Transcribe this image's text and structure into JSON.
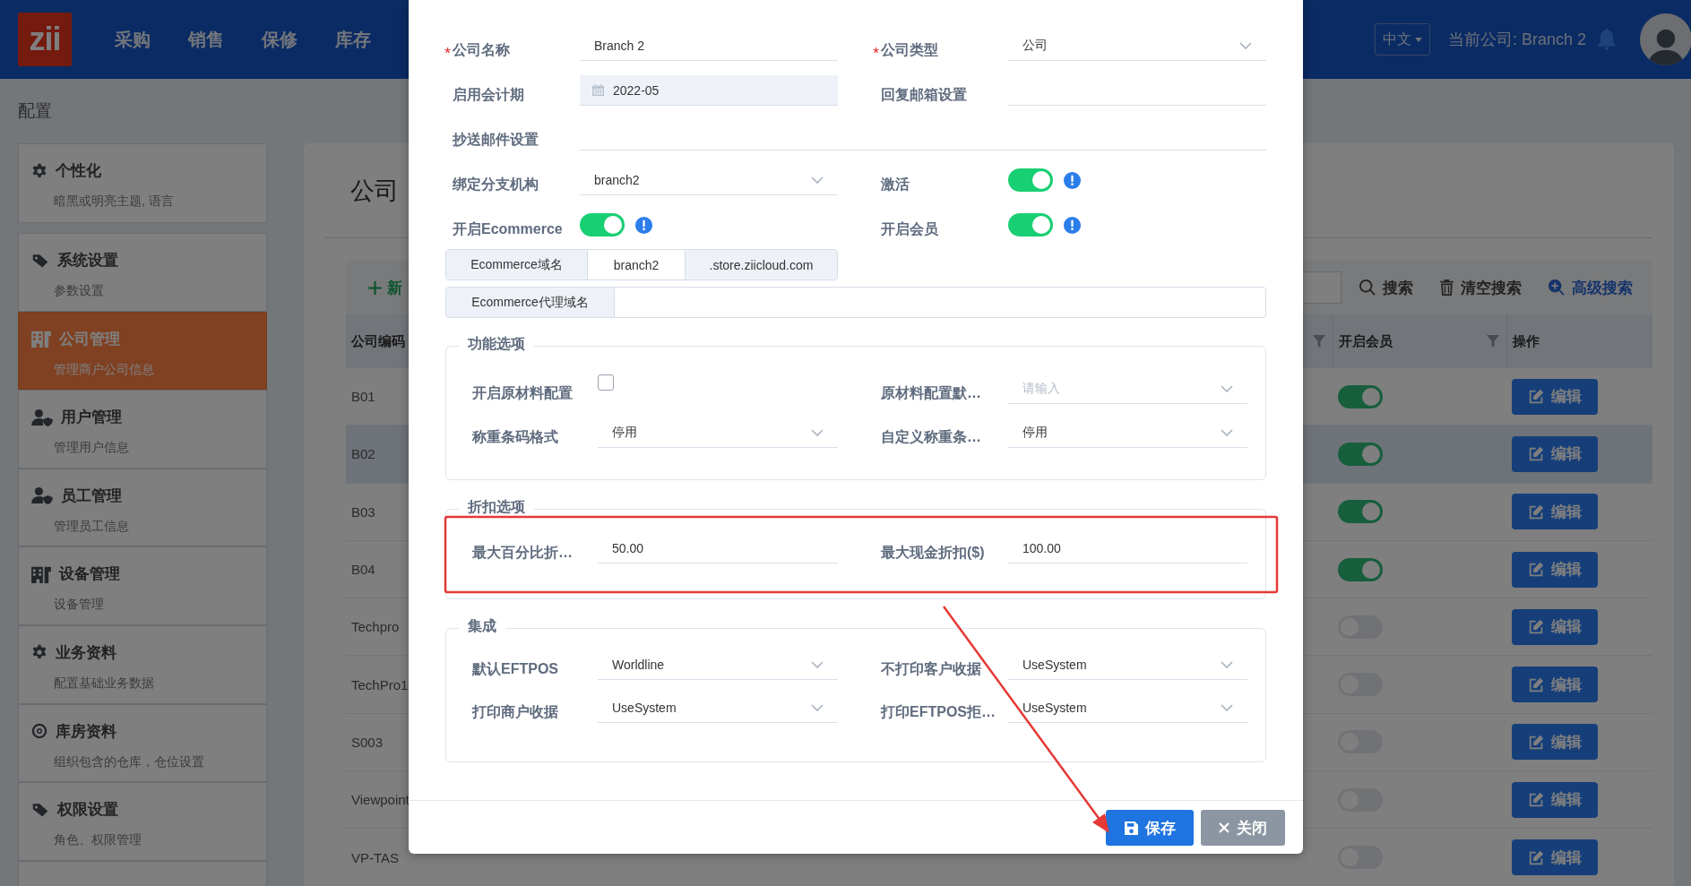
{
  "header": {
    "logo": "zii",
    "menu": [
      {
        "label": "采购"
      },
      {
        "label": "销售"
      },
      {
        "label": "保修"
      },
      {
        "label": "库存"
      }
    ],
    "language": "中文",
    "current_company": "当前公司: Branch 2"
  },
  "page_title": "配置",
  "sidebar": {
    "items": [
      {
        "title": "个性化",
        "subtitle": "暗黑或明亮主题, 语言",
        "selected": false
      },
      {
        "title": "系统设置",
        "subtitle": "参数设置",
        "selected": false
      },
      {
        "title": "公司管理",
        "subtitle": "管理商户公司信息",
        "selected": true
      },
      {
        "title": "用户管理",
        "subtitle": "管理用户信息",
        "selected": false
      },
      {
        "title": "员工管理",
        "subtitle": "管理员工信息",
        "selected": false
      },
      {
        "title": "设备管理",
        "subtitle": "设备管理",
        "selected": false
      },
      {
        "title": "业务资料",
        "subtitle": "配置基础业务数据",
        "selected": false
      },
      {
        "title": "库房资料",
        "subtitle": "组织包含的仓库，仓位设置",
        "selected": false
      },
      {
        "title": "权限设置",
        "subtitle": "角色、权限管理",
        "selected": false
      }
    ]
  },
  "main": {
    "title": "公司",
    "add_label": "新",
    "search_label": "搜索",
    "clear_label": "清空搜索",
    "advanced_label": "高级搜索",
    "table": {
      "columns": [
        {
          "label": "公司编码",
          "filter": true
        },
        {
          "label": "开启会员",
          "filter": true
        },
        {
          "label": "操作",
          "filter": false
        }
      ],
      "rows": [
        {
          "code": "B01",
          "member": true,
          "selected": false,
          "action": "编辑"
        },
        {
          "code": "B02",
          "member": true,
          "selected": true,
          "action": "编辑"
        },
        {
          "code": "B03",
          "member": true,
          "selected": false,
          "action": "编辑"
        },
        {
          "code": "B04",
          "member": true,
          "selected": false,
          "action": "编辑"
        },
        {
          "code": "Techpro",
          "member": false,
          "selected": false,
          "action": "编辑"
        },
        {
          "code": "TechPro1",
          "member": false,
          "selected": false,
          "action": "编辑"
        },
        {
          "code": "S003",
          "member": false,
          "selected": false,
          "action": "编辑"
        },
        {
          "code": "Viewpoint",
          "member": false,
          "selected": false,
          "action": "编辑"
        },
        {
          "code": "VP-TAS",
          "member": false,
          "selected": false,
          "action": "编辑"
        }
      ]
    }
  },
  "modal": {
    "rows": [
      {
        "fields": [
          {
            "label": "公司名称",
            "required": true,
            "kind": "text",
            "value": "Branch 2"
          },
          {
            "label": "公司类型",
            "required": true,
            "kind": "select",
            "value": "公司"
          }
        ]
      },
      {
        "fields": [
          {
            "label": "启用会计期",
            "required": false,
            "kind": "date",
            "value": "2022-05"
          },
          {
            "label": "回复邮箱设置",
            "required": false,
            "kind": "text"
          }
        ]
      },
      {
        "fields": [
          {
            "label": "抄送邮件设置",
            "required": false,
            "kind": "text"
          }
        ]
      },
      {
        "fields": [
          {
            "label": "绑定分支机构",
            "required": false,
            "kind": "select",
            "value": "branch2"
          },
          {
            "label": "激活",
            "required": false,
            "kind": "switch",
            "on": true
          }
        ]
      },
      {
        "fields": [
          {
            "label": "开启Ecommerce",
            "required": false,
            "kind": "switch",
            "on": true
          },
          {
            "label": "开启会员",
            "required": false,
            "kind": "switch",
            "on": true
          }
        ]
      }
    ],
    "domain": {
      "label": "Ecommerce域名",
      "value": "branch2",
      "suffix": ".store.ziicloud.com"
    },
    "proxy": {
      "label": "Ecommerce代理域名"
    },
    "sections": [
      {
        "title": "功能选项",
        "fields": [
          {
            "label": "开启原材料配置",
            "kind": "checkbox",
            "checked": false
          },
          {
            "label": "原材料配置默…",
            "kind": "select",
            "placeholder": "请输入"
          },
          {
            "label": "称重条码格式",
            "kind": "select",
            "value": "停用"
          },
          {
            "label": "自定义称重条…",
            "kind": "select",
            "value": "停用"
          }
        ]
      },
      {
        "title": "折扣选项",
        "fields": [
          {
            "label": "最大百分比折…",
            "kind": "text",
            "value": "50.00"
          },
          {
            "label": "最大现金折扣($)",
            "kind": "text",
            "value": "100.00"
          }
        ]
      },
      {
        "title": "集成",
        "fields": [
          {
            "label": "默认EFTPOS",
            "kind": "select",
            "value": "Worldline"
          },
          {
            "label": "不打印客户收据",
            "kind": "select",
            "value": "UseSystem"
          },
          {
            "label": "打印商户收据",
            "kind": "select",
            "value": "UseSystem"
          },
          {
            "label": "打印EFTPOS拒…",
            "kind": "select",
            "value": "UseSystem"
          }
        ]
      }
    ],
    "buttons": [
      {
        "label": "保存",
        "kind": "primary"
      },
      {
        "label": "关闭",
        "kind": "secondary"
      }
    ]
  }
}
